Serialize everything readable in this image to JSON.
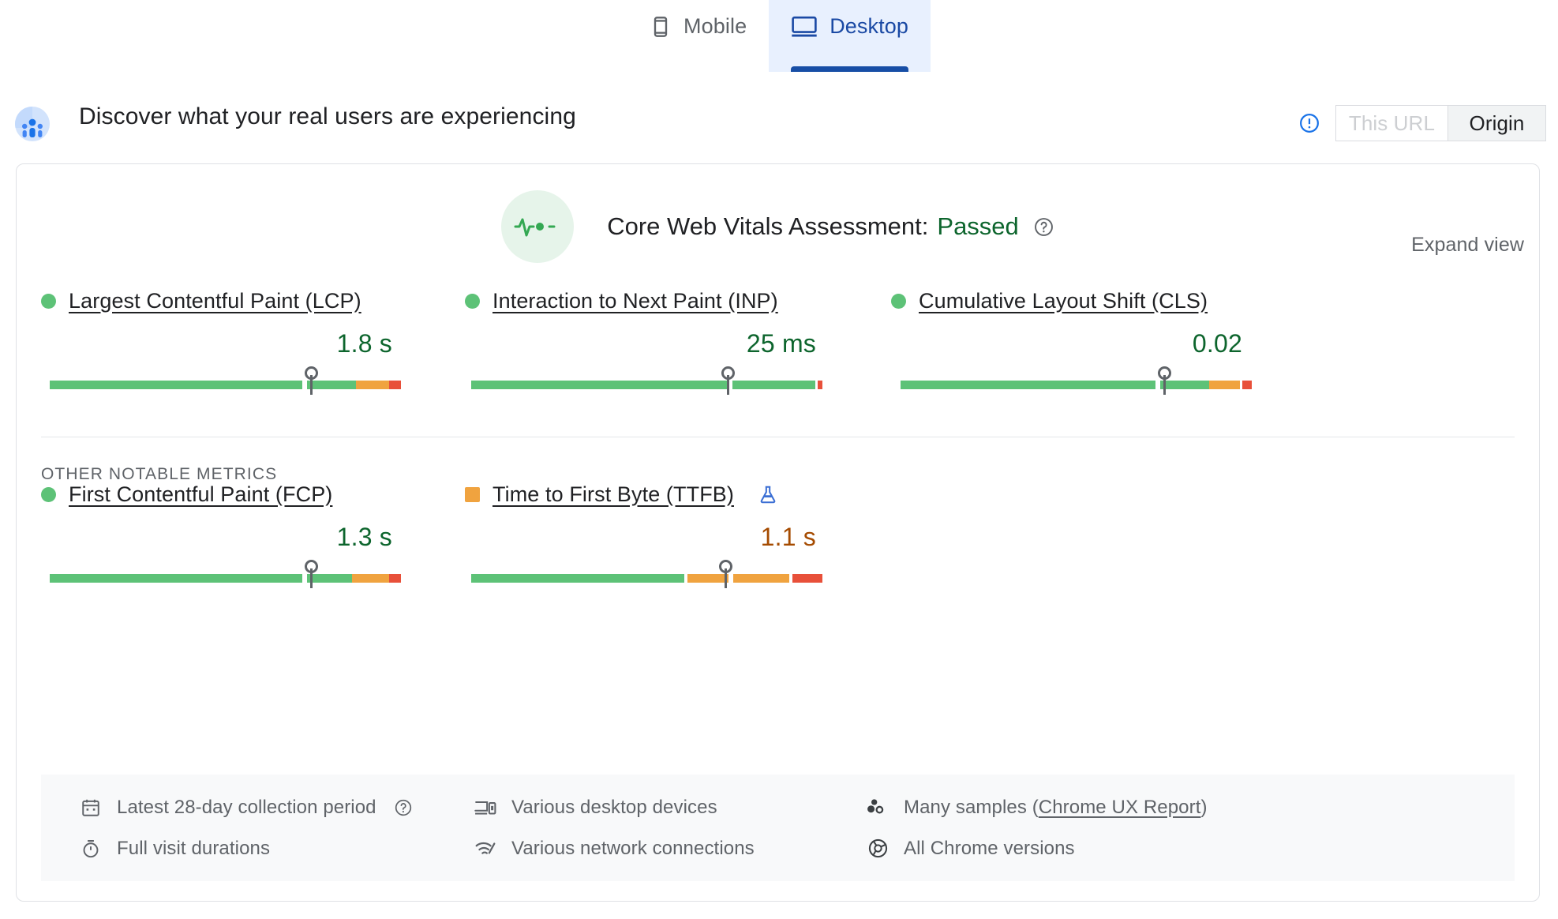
{
  "tabs": [
    {
      "label": "Mobile",
      "icon": "mobile-phone-icon",
      "selected": false
    },
    {
      "label": "Desktop",
      "icon": "desktop-monitor-icon",
      "selected": true
    }
  ],
  "section": {
    "title": "Discover what your real users are experiencing",
    "icon": "field-data-globe-icon",
    "info_icon": "info-circle-icon",
    "scope": {
      "this_url_label": "This URL",
      "origin_label": "Origin",
      "selected": "Origin"
    }
  },
  "assessment": {
    "icon": "pulse-heartbeat-icon",
    "label": "Core Web Vitals Assessment:",
    "status": "Passed",
    "status_color": "#0d652d",
    "help_icon": "help-circle-icon",
    "expand_view_label": "Expand view"
  },
  "core_web_vitals": [
    {
      "name": "Largest Contentful Paint (LCP)",
      "value": "1.8 s",
      "rating": "good",
      "indicator": "circle",
      "indicator_color": "#5dc277"
    },
    {
      "name": "Interaction to Next Paint (INP)",
      "value": "25 ms",
      "rating": "good",
      "indicator": "circle",
      "indicator_color": "#5dc277"
    },
    {
      "name": "Cumulative Layout Shift (CLS)",
      "value": "0.02",
      "rating": "good",
      "indicator": "circle",
      "indicator_color": "#5dc277"
    }
  ],
  "other_metrics_title": "OTHER NOTABLE METRICS",
  "other_metrics": [
    {
      "name": "First Contentful Paint (FCP)",
      "value": "1.3 s",
      "rating": "good",
      "indicator": "circle",
      "indicator_color": "#5dc277",
      "experimental": false
    },
    {
      "name": "Time to First Byte (TTFB)",
      "value": "1.1 s",
      "rating": "average",
      "indicator": "square",
      "indicator_color": "#f0a33f",
      "experimental": true,
      "experimental_icon": "flask-beaker-icon"
    }
  ],
  "footer": {
    "col1": [
      {
        "icon": "calendar-icon",
        "text": "Latest 28-day collection period",
        "help_icon": "help-circle-icon"
      },
      {
        "icon": "stopwatch-icon",
        "text": "Full visit durations"
      }
    ],
    "col2": [
      {
        "icon": "devices-icon",
        "text": "Various desktop devices"
      },
      {
        "icon": "network-signal-icon",
        "text": "Various network connections"
      }
    ],
    "col3": [
      {
        "icon": "samples-dots-icon",
        "text_before": "Many samples (",
        "link": "Chrome UX Report",
        "text_after": ")"
      },
      {
        "icon": "chrome-logo-icon",
        "text": "All Chrome versions"
      }
    ]
  },
  "colors": {
    "good": "#5dc277",
    "needs_improvement": "#f0a33f",
    "poor": "#e8503a",
    "brand_blue": "#174ea6",
    "tab_bg": "#e8f0fe"
  }
}
